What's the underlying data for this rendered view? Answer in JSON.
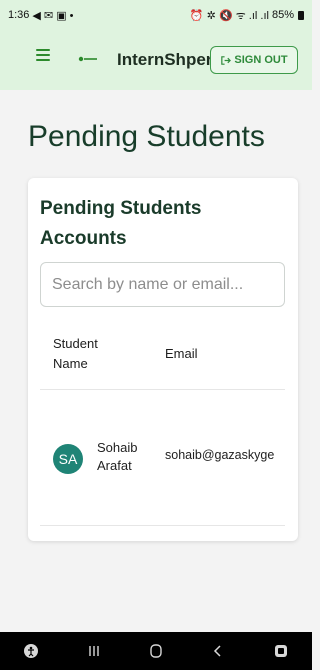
{
  "status_bar": {
    "time": "1:36",
    "left_icons": "◀ ✉ ▣ •",
    "right_icons": "⏰ ✲ 🔇 ᯤ .ıl .ıl",
    "battery_text": "85%"
  },
  "app_bar": {
    "title": "InternShpere",
    "sign_out_label": "SIGN OUT"
  },
  "page": {
    "title": "Pending Students"
  },
  "card": {
    "title": "Pending Students Accounts",
    "search": {
      "placeholder": "Search by name or email...",
      "value": ""
    },
    "columns": {
      "name": "Student Name",
      "email": "Email"
    },
    "rows": [
      {
        "initials": "SA",
        "name": "Sohaib Arafat",
        "email": "sohaib@gazaskyge"
      }
    ]
  },
  "colors": {
    "app_bar_bg": "#dff3df",
    "accent_green": "#2e8a3a",
    "avatar_bg": "#1f8476",
    "title_text": "#183d2a"
  },
  "icons": {
    "menu": "hamburger-icon",
    "sign_out": "sign-out-icon",
    "nav_recents": "recents-icon",
    "nav_home": "home-icon",
    "nav_back": "back-icon"
  }
}
